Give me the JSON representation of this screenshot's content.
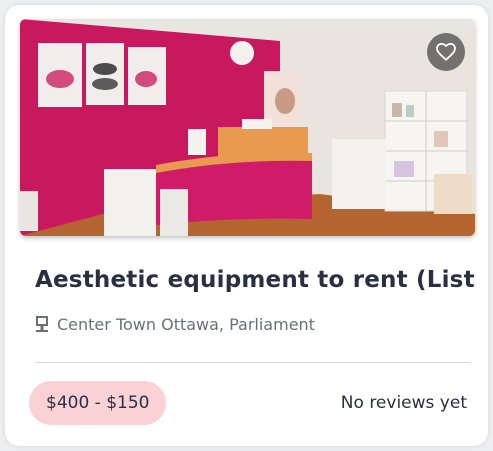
{
  "listing": {
    "title": "Aesthetic equipment to rent (Listing",
    "location": "Center Town Ottawa, Parliament",
    "price": "$400 - $150",
    "reviews": "No reviews yet",
    "icons": {
      "favorite": "heart-icon",
      "location": "location-pin-icon"
    }
  },
  "colors": {
    "price_badge_bg": "#fad2d6",
    "title_text": "#2a2f42",
    "wall_accent": "#c8195e"
  }
}
